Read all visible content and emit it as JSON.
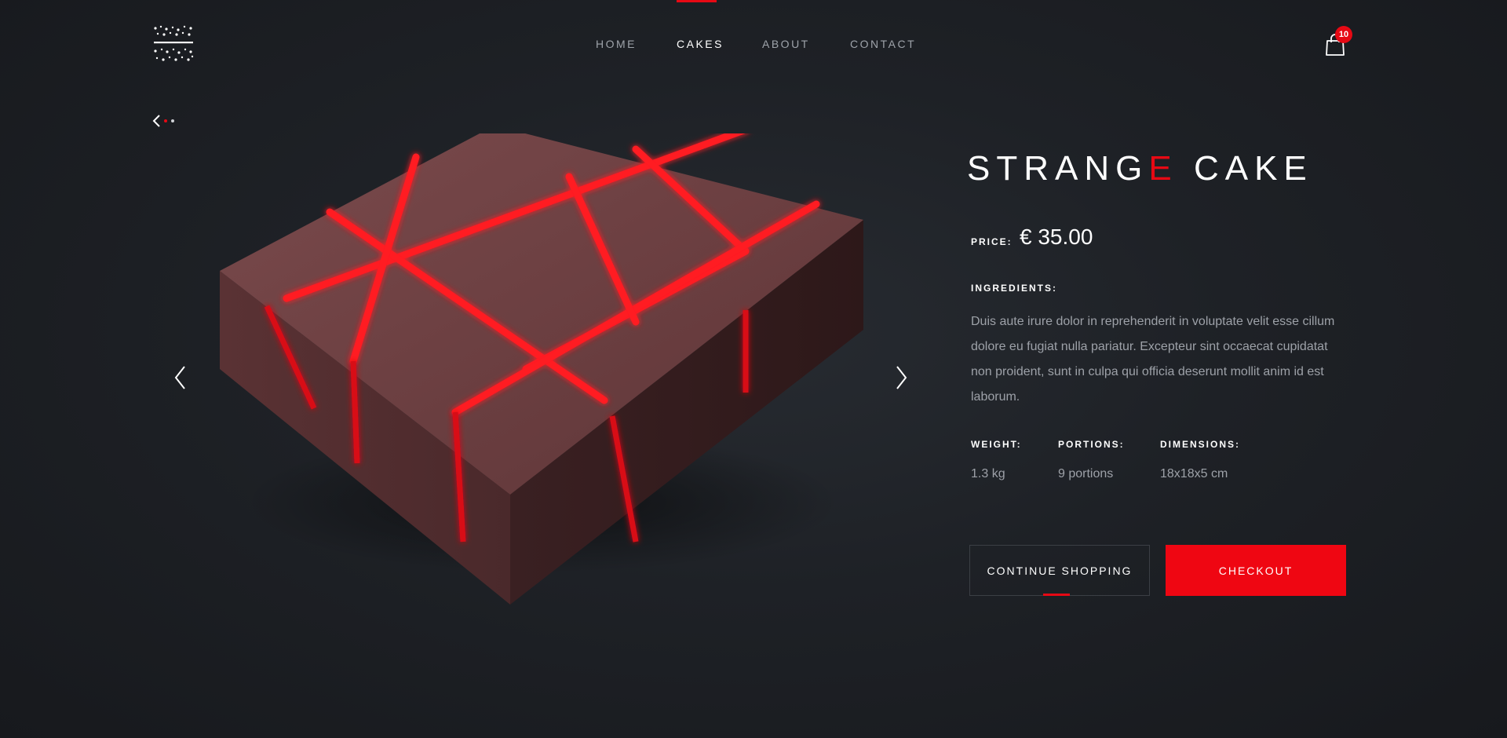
{
  "header": {
    "logo_icon": "dots-grid-logo-icon",
    "nav": [
      {
        "label": "HOME",
        "active": false
      },
      {
        "label": "CAKES",
        "active": true
      },
      {
        "label": "ABOUT",
        "active": false
      },
      {
        "label": "CONTACT",
        "active": false
      }
    ],
    "cart": {
      "icon": "shopping-bag-icon",
      "count": "10"
    }
  },
  "gallery": {
    "back_icon": "chevron-left-icon",
    "prev_icon": "chevron-left-icon",
    "next_icon": "chevron-right-icon",
    "image_alt": "geometric chocolate cake with red glaze",
    "slide_count": 2,
    "active_slide": 1
  },
  "product": {
    "title_part1": "STRANG",
    "title_accent": "E",
    "title_part2": " CAKE",
    "price_label": "PRICE:",
    "price_value": "€ 35.00",
    "ingredients_label": "INGREDIENTS:",
    "ingredients_text": "Duis aute irure dolor in reprehenderit in voluptate velit esse cillum dolore eu fugiat nulla pariatur. Excepteur sint occaecat cupidatat non proident, sunt in culpa qui officia deserunt mollit anim id est laborum.",
    "specs": [
      {
        "label": "WEIGHT:",
        "value": "1.3 kg"
      },
      {
        "label": "PORTIONS:",
        "value": "9 portions"
      },
      {
        "label": "DIMENSIONS:",
        "value": "18x18x5 cm"
      }
    ]
  },
  "actions": {
    "continue_label": "CONTINUE SHOPPING",
    "checkout_label": "CHECKOUT"
  },
  "colors": {
    "accent": "#e60914",
    "background": "#1e2126",
    "muted_text": "#9da1a8"
  }
}
